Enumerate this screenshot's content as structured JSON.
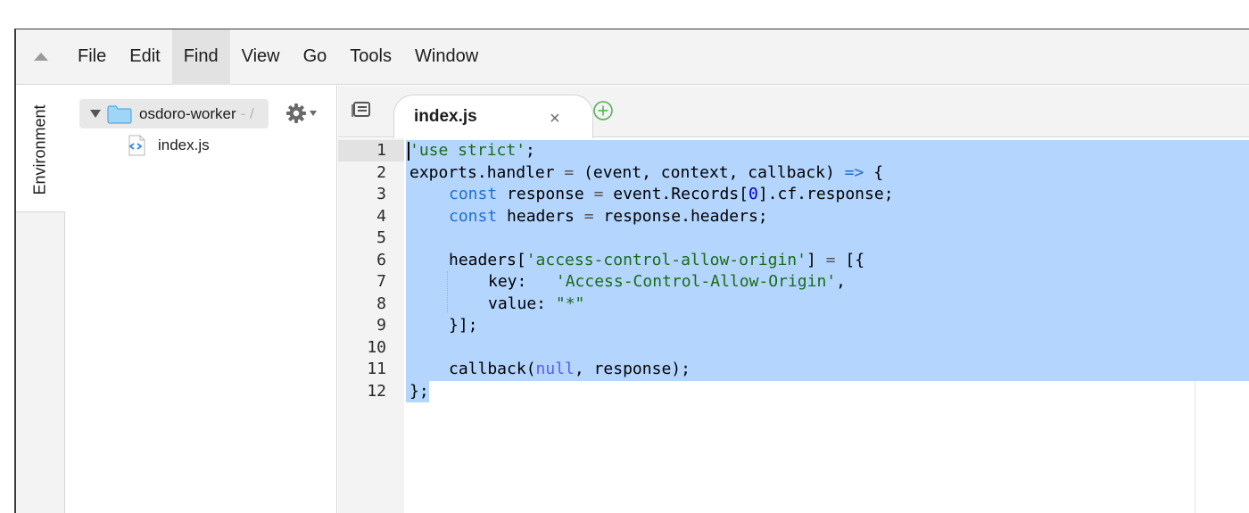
{
  "menu": {
    "items": [
      {
        "label": "File"
      },
      {
        "label": "Edit"
      },
      {
        "label": "Find"
      },
      {
        "label": "View"
      },
      {
        "label": "Go"
      },
      {
        "label": "Tools"
      },
      {
        "label": "Window"
      }
    ],
    "active_item": "Find"
  },
  "sidebar": {
    "environment_tab_label": "Environment"
  },
  "tree": {
    "root_label": "osdoro-worker",
    "root_suffix": "- /",
    "files": [
      {
        "name": "index.js"
      }
    ]
  },
  "editor": {
    "tab_label": "index.js",
    "close_glyph": "×",
    "line_numbers": [
      "1",
      "2",
      "3",
      "4",
      "5",
      "6",
      "7",
      "8",
      "9",
      "10",
      "11",
      "12"
    ],
    "lines": {
      "l1_str": "'use strict'",
      "l1_semi": ";",
      "l2_a": "exports.handler ",
      "l2_eq": "=",
      "l2_b": " (event, context, callback) ",
      "l2_arrow": "=>",
      "l2_c": " {",
      "l3_kw": "const",
      "l3_a": " response ",
      "l3_eq": "=",
      "l3_b": " event.Records[",
      "l3_num": "0",
      "l3_c": "].cf.response;",
      "l4_kw": "const",
      "l4_a": " headers ",
      "l4_eq": "=",
      "l4_b": " response.headers;",
      "l6_a": "headers[",
      "l6_str": "'access-control-allow-origin'",
      "l6_b": "] ",
      "l6_eq": "=",
      "l6_c": " [{",
      "l7_a": "key:   ",
      "l7_str": "'Access-Control-Allow-Origin'",
      "l7_b": ",",
      "l8_a": "value: ",
      "l8_str": "\"*\"",
      "l9_a": "}];",
      "l11_a": "callback(",
      "l11_const": "null",
      "l11_b": ", response);",
      "l12_a": "};"
    }
  },
  "colors": {
    "selection": "#b4d5fe",
    "string": "#1a6b1a",
    "keyword": "#1f6fd1",
    "folder": "#9fd5f7",
    "plus": "#4caf50"
  }
}
